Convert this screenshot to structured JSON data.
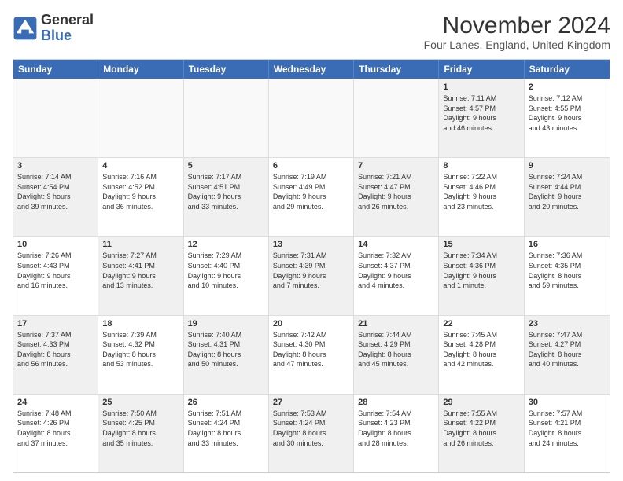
{
  "header": {
    "logo_line1": "General",
    "logo_line2": "Blue",
    "title": "November 2024",
    "subtitle": "Four Lanes, England, United Kingdom"
  },
  "weekdays": [
    "Sunday",
    "Monday",
    "Tuesday",
    "Wednesday",
    "Thursday",
    "Friday",
    "Saturday"
  ],
  "rows": [
    [
      {
        "day": "",
        "info": "",
        "shaded": false,
        "empty": true
      },
      {
        "day": "",
        "info": "",
        "shaded": false,
        "empty": true
      },
      {
        "day": "",
        "info": "",
        "shaded": false,
        "empty": true
      },
      {
        "day": "",
        "info": "",
        "shaded": false,
        "empty": true
      },
      {
        "day": "",
        "info": "",
        "shaded": false,
        "empty": true
      },
      {
        "day": "1",
        "info": "Sunrise: 7:11 AM\nSunset: 4:57 PM\nDaylight: 9 hours\nand 46 minutes.",
        "shaded": true,
        "empty": false
      },
      {
        "day": "2",
        "info": "Sunrise: 7:12 AM\nSunset: 4:55 PM\nDaylight: 9 hours\nand 43 minutes.",
        "shaded": false,
        "empty": false
      }
    ],
    [
      {
        "day": "3",
        "info": "Sunrise: 7:14 AM\nSunset: 4:54 PM\nDaylight: 9 hours\nand 39 minutes.",
        "shaded": true,
        "empty": false
      },
      {
        "day": "4",
        "info": "Sunrise: 7:16 AM\nSunset: 4:52 PM\nDaylight: 9 hours\nand 36 minutes.",
        "shaded": false,
        "empty": false
      },
      {
        "day": "5",
        "info": "Sunrise: 7:17 AM\nSunset: 4:51 PM\nDaylight: 9 hours\nand 33 minutes.",
        "shaded": true,
        "empty": false
      },
      {
        "day": "6",
        "info": "Sunrise: 7:19 AM\nSunset: 4:49 PM\nDaylight: 9 hours\nand 29 minutes.",
        "shaded": false,
        "empty": false
      },
      {
        "day": "7",
        "info": "Sunrise: 7:21 AM\nSunset: 4:47 PM\nDaylight: 9 hours\nand 26 minutes.",
        "shaded": true,
        "empty": false
      },
      {
        "day": "8",
        "info": "Sunrise: 7:22 AM\nSunset: 4:46 PM\nDaylight: 9 hours\nand 23 minutes.",
        "shaded": false,
        "empty": false
      },
      {
        "day": "9",
        "info": "Sunrise: 7:24 AM\nSunset: 4:44 PM\nDaylight: 9 hours\nand 20 minutes.",
        "shaded": true,
        "empty": false
      }
    ],
    [
      {
        "day": "10",
        "info": "Sunrise: 7:26 AM\nSunset: 4:43 PM\nDaylight: 9 hours\nand 16 minutes.",
        "shaded": false,
        "empty": false
      },
      {
        "day": "11",
        "info": "Sunrise: 7:27 AM\nSunset: 4:41 PM\nDaylight: 9 hours\nand 13 minutes.",
        "shaded": true,
        "empty": false
      },
      {
        "day": "12",
        "info": "Sunrise: 7:29 AM\nSunset: 4:40 PM\nDaylight: 9 hours\nand 10 minutes.",
        "shaded": false,
        "empty": false
      },
      {
        "day": "13",
        "info": "Sunrise: 7:31 AM\nSunset: 4:39 PM\nDaylight: 9 hours\nand 7 minutes.",
        "shaded": true,
        "empty": false
      },
      {
        "day": "14",
        "info": "Sunrise: 7:32 AM\nSunset: 4:37 PM\nDaylight: 9 hours\nand 4 minutes.",
        "shaded": false,
        "empty": false
      },
      {
        "day": "15",
        "info": "Sunrise: 7:34 AM\nSunset: 4:36 PM\nDaylight: 9 hours\nand 1 minute.",
        "shaded": true,
        "empty": false
      },
      {
        "day": "16",
        "info": "Sunrise: 7:36 AM\nSunset: 4:35 PM\nDaylight: 8 hours\nand 59 minutes.",
        "shaded": false,
        "empty": false
      }
    ],
    [
      {
        "day": "17",
        "info": "Sunrise: 7:37 AM\nSunset: 4:33 PM\nDaylight: 8 hours\nand 56 minutes.",
        "shaded": true,
        "empty": false
      },
      {
        "day": "18",
        "info": "Sunrise: 7:39 AM\nSunset: 4:32 PM\nDaylight: 8 hours\nand 53 minutes.",
        "shaded": false,
        "empty": false
      },
      {
        "day": "19",
        "info": "Sunrise: 7:40 AM\nSunset: 4:31 PM\nDaylight: 8 hours\nand 50 minutes.",
        "shaded": true,
        "empty": false
      },
      {
        "day": "20",
        "info": "Sunrise: 7:42 AM\nSunset: 4:30 PM\nDaylight: 8 hours\nand 47 minutes.",
        "shaded": false,
        "empty": false
      },
      {
        "day": "21",
        "info": "Sunrise: 7:44 AM\nSunset: 4:29 PM\nDaylight: 8 hours\nand 45 minutes.",
        "shaded": true,
        "empty": false
      },
      {
        "day": "22",
        "info": "Sunrise: 7:45 AM\nSunset: 4:28 PM\nDaylight: 8 hours\nand 42 minutes.",
        "shaded": false,
        "empty": false
      },
      {
        "day": "23",
        "info": "Sunrise: 7:47 AM\nSunset: 4:27 PM\nDaylight: 8 hours\nand 40 minutes.",
        "shaded": true,
        "empty": false
      }
    ],
    [
      {
        "day": "24",
        "info": "Sunrise: 7:48 AM\nSunset: 4:26 PM\nDaylight: 8 hours\nand 37 minutes.",
        "shaded": false,
        "empty": false
      },
      {
        "day": "25",
        "info": "Sunrise: 7:50 AM\nSunset: 4:25 PM\nDaylight: 8 hours\nand 35 minutes.",
        "shaded": true,
        "empty": false
      },
      {
        "day": "26",
        "info": "Sunrise: 7:51 AM\nSunset: 4:24 PM\nDaylight: 8 hours\nand 33 minutes.",
        "shaded": false,
        "empty": false
      },
      {
        "day": "27",
        "info": "Sunrise: 7:53 AM\nSunset: 4:24 PM\nDaylight: 8 hours\nand 30 minutes.",
        "shaded": true,
        "empty": false
      },
      {
        "day": "28",
        "info": "Sunrise: 7:54 AM\nSunset: 4:23 PM\nDaylight: 8 hours\nand 28 minutes.",
        "shaded": false,
        "empty": false
      },
      {
        "day": "29",
        "info": "Sunrise: 7:55 AM\nSunset: 4:22 PM\nDaylight: 8 hours\nand 26 minutes.",
        "shaded": true,
        "empty": false
      },
      {
        "day": "30",
        "info": "Sunrise: 7:57 AM\nSunset: 4:21 PM\nDaylight: 8 hours\nand 24 minutes.",
        "shaded": false,
        "empty": false
      }
    ]
  ]
}
